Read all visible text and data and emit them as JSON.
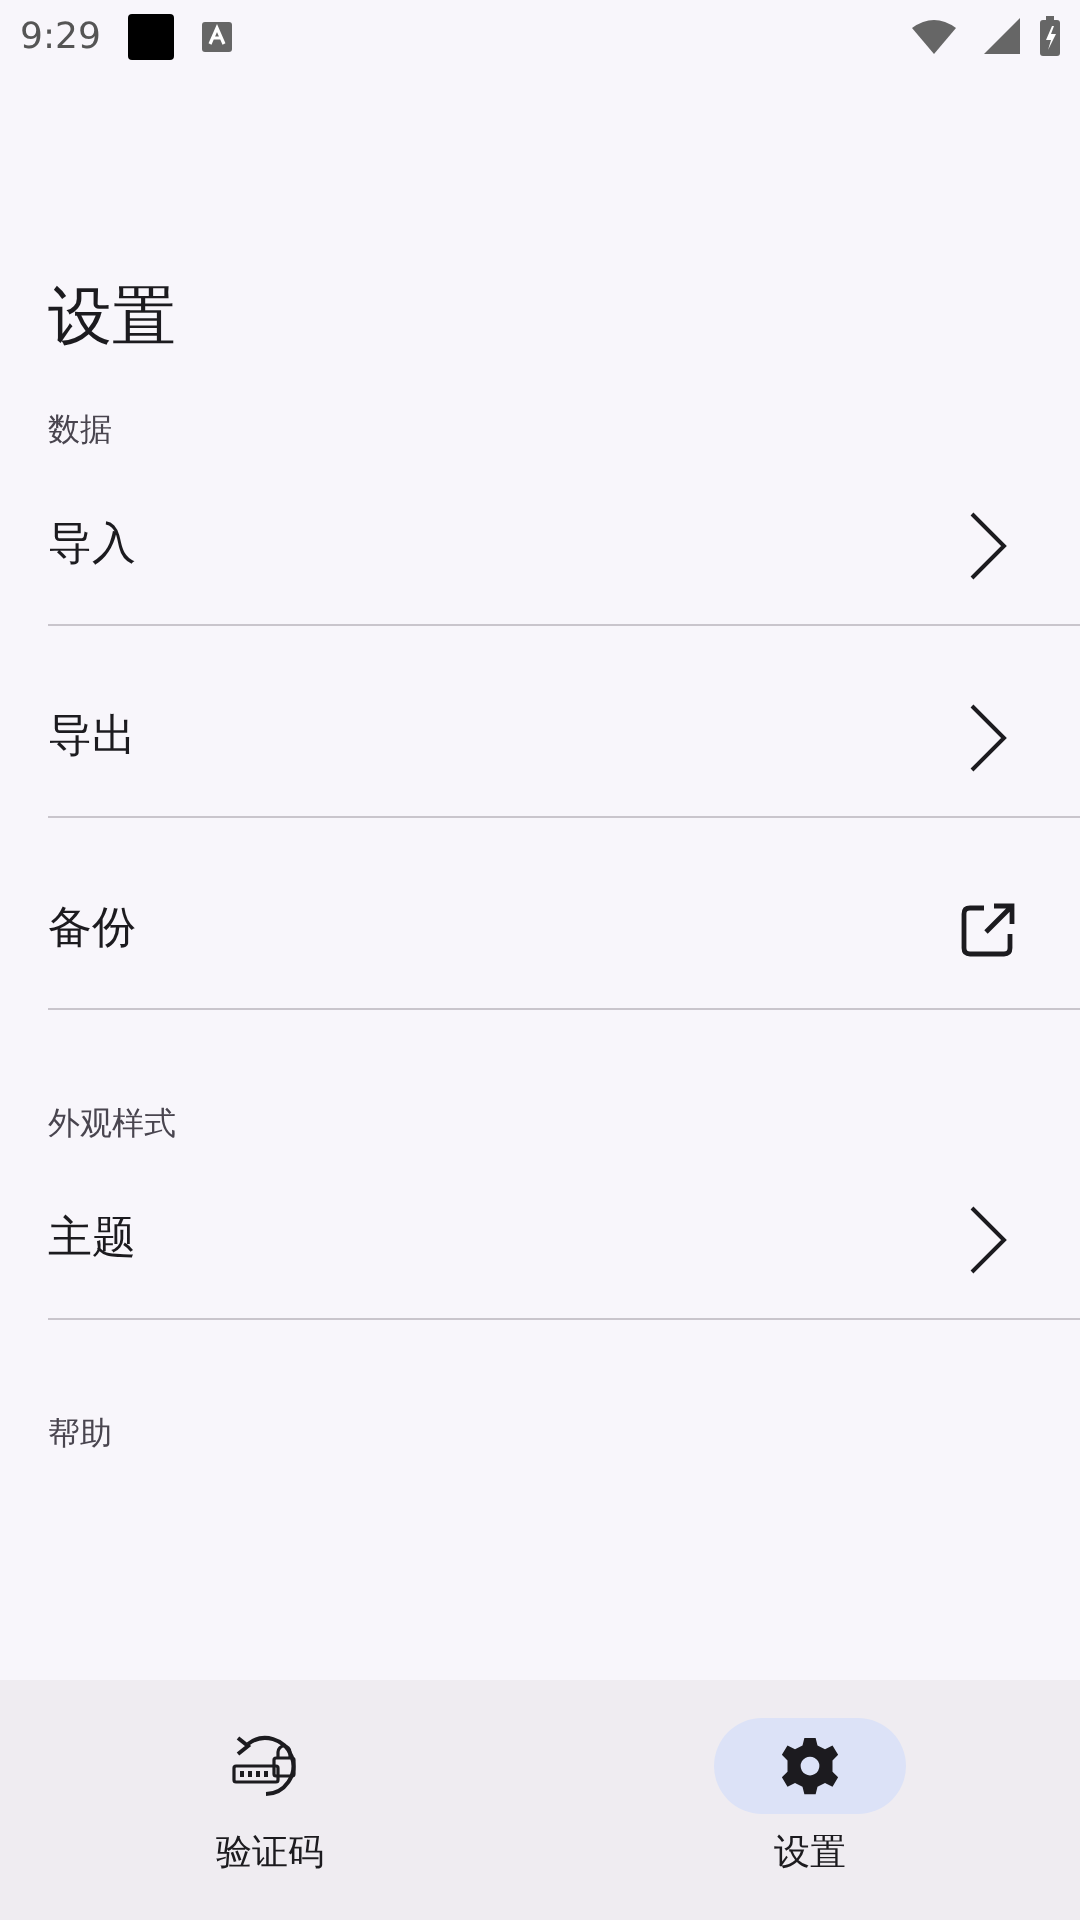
{
  "status_bar": {
    "time": "9:29"
  },
  "title": "设置",
  "sections": [
    {
      "header": "数据",
      "items": [
        {
          "label": "导入",
          "kind": "chevron"
        },
        {
          "label": "导出",
          "kind": "chevron"
        },
        {
          "label": "备份",
          "kind": "external"
        }
      ]
    },
    {
      "header": "外观样式",
      "items": [
        {
          "label": "主题",
          "kind": "chevron"
        }
      ]
    },
    {
      "header": "帮助"
    }
  ],
  "bottom_nav": [
    {
      "label": "验证码",
      "kind": "codes",
      "selected": false
    },
    {
      "label": "设置",
      "kind": "settings",
      "selected": true
    }
  ]
}
